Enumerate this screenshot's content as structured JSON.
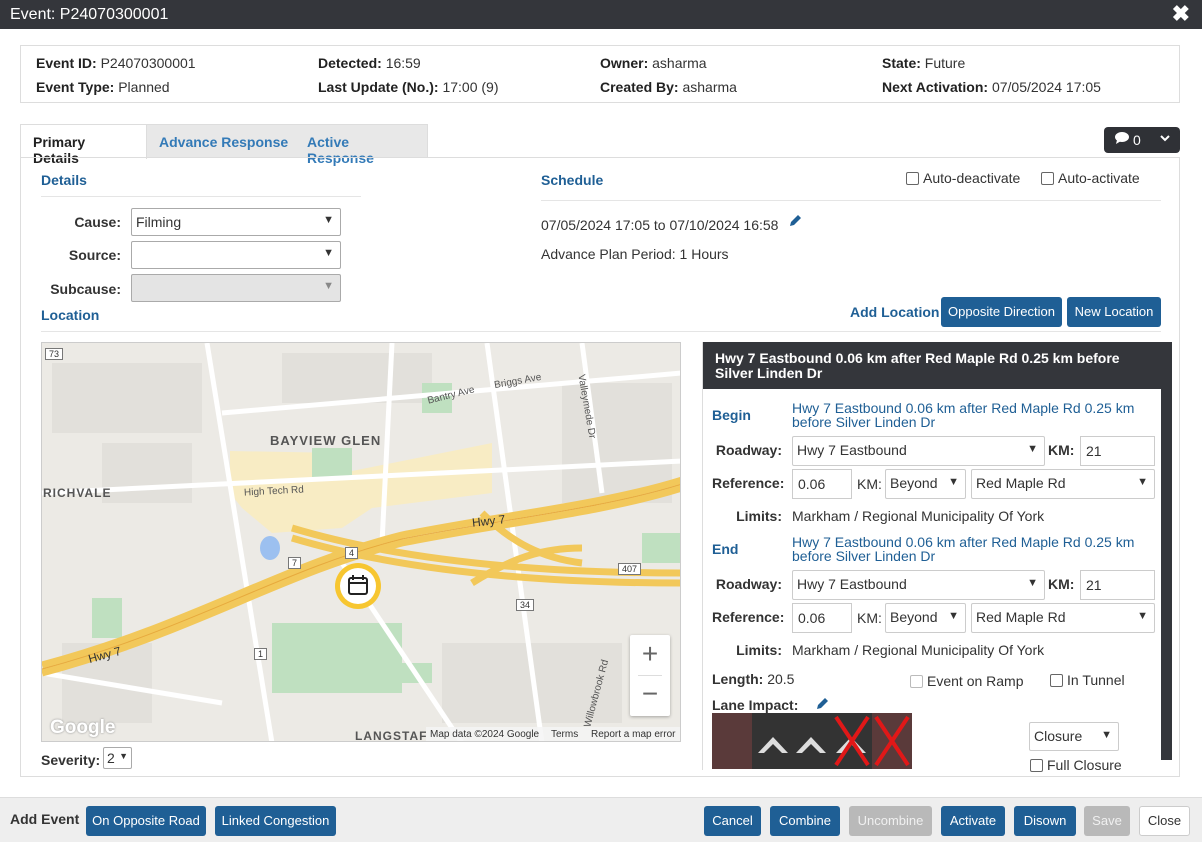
{
  "window": {
    "title": "Event: P24070300001"
  },
  "summary": {
    "event_id_label": "Event ID:",
    "event_id": "P24070300001",
    "event_type_label": "Event Type:",
    "event_type": "Planned",
    "detected_label": "Detected:",
    "detected": "16:59",
    "last_update_label": "Last Update (No.):",
    "last_update": "17:00 (9)",
    "owner_label": "Owner:",
    "owner": "asharma",
    "created_by_label": "Created By:",
    "created_by": "asharma",
    "state_label": "State:",
    "state": "Future",
    "next_activation_label": "Next Activation:",
    "next_activation": "07/05/2024 17:05"
  },
  "tabs": [
    {
      "label": "Primary Details",
      "active": true
    },
    {
      "label": "Advance Response",
      "active": false
    },
    {
      "label": "Active Response",
      "active": false
    }
  ],
  "comments": {
    "count": "0"
  },
  "details": {
    "title": "Details",
    "cause_label": "Cause:",
    "cause": "Filming",
    "source_label": "Source:",
    "source": "",
    "subcause_label": "Subcause:",
    "subcause": ""
  },
  "schedule": {
    "title": "Schedule",
    "auto_deactivate": "Auto-deactivate",
    "auto_activate": "Auto-activate",
    "range": "07/05/2024 17:05 to 07/10/2024 16:58",
    "advance_plan": "Advance Plan Period: 1 Hours"
  },
  "location": {
    "title": "Location",
    "add_location": "Add Location",
    "opposite_direction": "Opposite Direction",
    "new_location": "New Location",
    "header": "Hwy 7 Eastbound 0.06 km after Red Maple Rd 0.25 km before Silver Linden Dr",
    "begin_label": "Begin",
    "begin_desc": "Hwy 7 Eastbound 0.06 km after Red Maple Rd 0.25 km before Silver Linden Dr",
    "end_label": "End",
    "end_desc": "Hwy 7 Eastbound 0.06 km after Red Maple Rd 0.25 km before Silver Linden Dr",
    "roadway_label": "Roadway:",
    "roadway": "Hwy 7 Eastbound",
    "km_label": "KM:",
    "km": "21",
    "reference_label": "Reference:",
    "ref_value": "0.06",
    "ref_km_label": "KM:",
    "ref_direction": "Beyond",
    "ref_road": "Red Maple Rd",
    "limits_label": "Limits:",
    "limits": "Markham / Regional Municipality Of York",
    "length_label": "Length:",
    "length": "20.5",
    "event_on_ramp": "Event on Ramp",
    "in_tunnel": "In Tunnel",
    "lane_impact_label": "Lane Impact:",
    "lane_status": "Closure",
    "full_closure": "Full Closure"
  },
  "map": {
    "labels": {
      "bayview_glen": "BAYVIEW GLEN",
      "richvale": "RICHVALE",
      "langstaff": "LANGSTAF",
      "bantry": "Bantry Ave",
      "briggs": "Briggs Ave",
      "valleymede": "Valleymede Dr",
      "hightech": "High Tech Rd",
      "hwy7_a": "Hwy 7",
      "hwy7_b": "Hwy 7",
      "willowbrook": "Willowbrook Rd",
      "shield_73": "73",
      "shield_7": "7",
      "shield_407": "407",
      "shield_34": "34",
      "shield_1": "1",
      "shield_4": "4"
    },
    "attribution": "Map data ©2024 Google",
    "terms": "Terms",
    "report": "Report a map error",
    "logo": "Google",
    "zoom_in": "+",
    "zoom_out": "−"
  },
  "severity": {
    "label": "Severity:",
    "value": "2"
  },
  "footer": {
    "add_event": "Add Event",
    "on_opposite_road": "On Opposite Road",
    "linked_congestion": "Linked Congestion",
    "cancel": "Cancel",
    "combine": "Combine",
    "uncombine": "Uncombine",
    "activate": "Activate",
    "disown": "Disown",
    "save": "Save",
    "close": "Close"
  },
  "colors": {
    "header": "#34363b",
    "primary": "#1f5f95",
    "link": "#337ab7",
    "closure_x": "#e01818"
  },
  "icons": {
    "close": "close-icon",
    "comment": "comment-icon",
    "pencil": "pencil-icon",
    "calendar": "calendar-icon"
  }
}
